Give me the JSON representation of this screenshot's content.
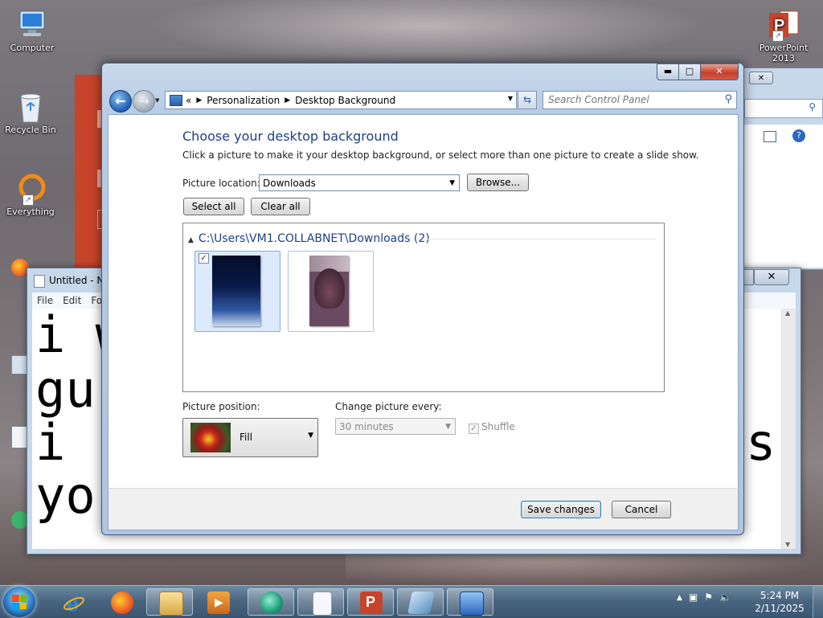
{
  "desktop": {
    "icons": [
      {
        "label": "Computer"
      },
      {
        "label": "Recycle Bin"
      },
      {
        "label": "Everything"
      },
      {
        "label": "PowerPoint 2013"
      }
    ]
  },
  "notepad": {
    "title": "Untitled - No",
    "menus": [
      "File",
      "Edit",
      "Fo"
    ],
    "lines": [
      "i w",
      "gu",
      "i",
      "yo"
    ],
    "line_right": "s"
  },
  "window": {
    "min_glyph": "▬",
    "max_glyph": "□",
    "close_glyph": "✕",
    "back_glyph": "←",
    "fwd_glyph": "→",
    "breadcrumb": [
      "Personalization",
      "Desktop Background"
    ],
    "breadcrumb_prefix": "«",
    "search_placeholder": "Search Control Panel"
  },
  "content": {
    "heading": "Choose your desktop background",
    "subtext": "Click a picture to make it your desktop background, or select more than one picture to create a slide show.",
    "picture_location_label": "Picture location:",
    "picture_location_value": "Downloads",
    "browse_label": "Browse...",
    "select_all_label": "Select all",
    "clear_all_label": "Clear all",
    "group_header": "C:\\Users\\VM1.COLLABNET\\Downloads (2)",
    "images": [
      {
        "name": "dark-blue-gradient",
        "checked": true
      },
      {
        "name": "purple-photo",
        "checked": false
      }
    ],
    "picture_position_label": "Picture position:",
    "picture_position_value": "Fill",
    "change_every_label": "Change picture every:",
    "change_every_value": "30 minutes",
    "shuffle_label": "Shuffle",
    "shuffle_checked": true
  },
  "footer": {
    "save_label": "Save changes",
    "cancel_label": "Cancel"
  },
  "taskbar": {
    "pinned": [
      "internet-explorer",
      "firefox",
      "file-explorer",
      "media-player",
      "app-green",
      "notepad",
      "powerpoint",
      "app-flat",
      "control-panel"
    ],
    "time": "5:24 PM",
    "date": "2/11/2025"
  },
  "colors": {
    "accent": "#1e3f8a",
    "titlebar": "#b8cce4",
    "close_red": "#c7402a"
  }
}
